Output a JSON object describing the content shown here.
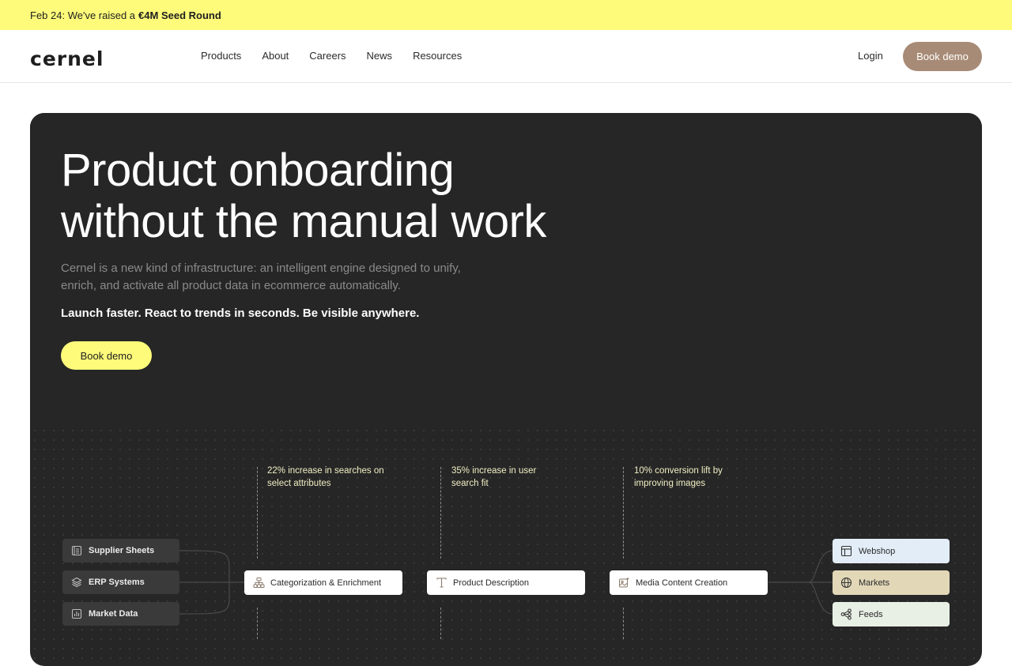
{
  "banner": {
    "prefix": "Feb 24: We've raised a",
    "highlight": "€4M Seed Round"
  },
  "nav": {
    "logo": "cernel",
    "items": [
      "Products",
      "About",
      "Careers",
      "News",
      "Resources"
    ],
    "login": "Login",
    "cta": "Book demo"
  },
  "hero": {
    "title_line1": "Product onboarding",
    "title_line2": "without the manual work",
    "subtitle": "Cernel is a new kind of infrastructure: an intelligent engine designed to unify, enrich, and activate all product data in ecommerce automatically.",
    "tagline": "Launch faster. React to trends in seconds. Be visible anywhere.",
    "cta": "Book demo"
  },
  "diagram": {
    "stats": [
      "22% increase in searches on select attributes",
      "35% increase in user search fit",
      "10% conversion lift by improving images"
    ],
    "sources": [
      "Supplier Sheets",
      "ERP Systems",
      "Market Data"
    ],
    "processes": [
      "Categorization & Enrichment",
      "Product Description",
      "Media Content Creation"
    ],
    "destinations": [
      {
        "label": "Webshop",
        "color": "#e3edf7"
      },
      {
        "label": "Markets",
        "color": "#e2d8b8"
      },
      {
        "label": "Feeds",
        "color": "#e8efe5"
      }
    ],
    "icons": {
      "sources": [
        "sheet-icon",
        "layers-icon",
        "bar-chart-icon"
      ],
      "processes": [
        "hierarchy-icon",
        "text-icon",
        "image-sparkle-icon"
      ],
      "destinations": [
        "layout-icon",
        "globe-icon",
        "share-nodes-icon"
      ]
    }
  }
}
